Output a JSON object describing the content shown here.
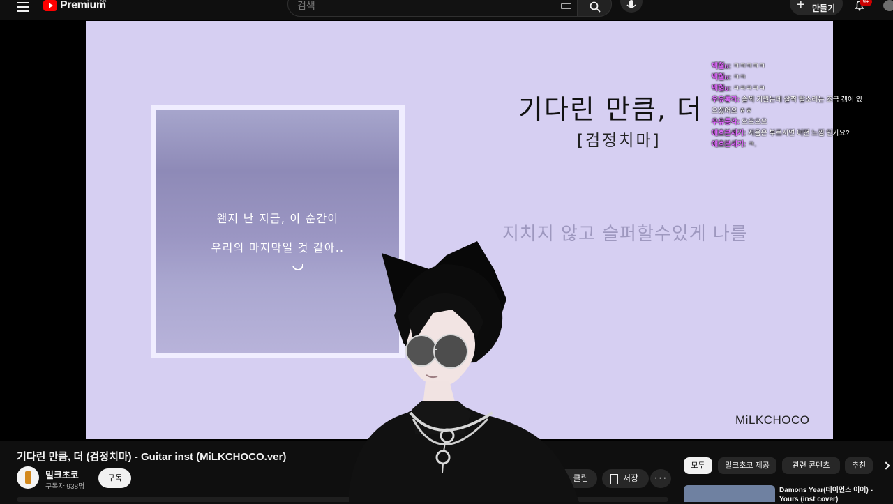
{
  "header": {
    "brand": "Premium",
    "region": "KR",
    "search_placeholder": "검색",
    "create_label": "만들기",
    "notification_badge": "9+",
    "icons": [
      "menu-icon",
      "youtube-logo-icon",
      "keyboard-icon",
      "search-icon",
      "microphone-icon",
      "plus-icon",
      "bell-icon"
    ]
  },
  "video": {
    "frame_lines": [
      "왠지 난 지금, 이 순간이",
      "우리의 마지막일 것 같아.."
    ],
    "song_title": "기다린 만큼, 더",
    "artist": "[검정치마]",
    "lyric": "지치지 않고 슬퍼할수있게 나를",
    "watermark": "MiLKCHOCO",
    "chat": [
      {
        "name": "백혈u:",
        "message": "ㅋㅋㅋㅋㅋ"
      },
      {
        "name": "백혈u:",
        "message": "ㅋㅋ"
      },
      {
        "name": "백혈u:",
        "message": "ㅋㅋㅋㅋㅋ"
      },
      {
        "name": "우유통각:",
        "message": "슬쩍 기웠는데 살짝 탈소리는  조금 갱이 있"
      },
      {
        "name": "",
        "message": "으셨어요 ㅎㅎ"
      },
      {
        "name": "우유통각:",
        "message": "으으으으"
      },
      {
        "name": "얘흐븐세기:",
        "message": "저음은 부르시면 어떤 느낌 인가요?"
      },
      {
        "name": "얘흐븐세기:",
        "message": "ㅋ."
      }
    ]
  },
  "below": {
    "title": "기다린 만큼, 더 (검정치마) - Guitar inst (MiLKCHOCO.ver)",
    "channel_name": "밀크초코",
    "subscribers": "구독자 938명",
    "subscribe": "구독",
    "clip": "클립",
    "save": "저장",
    "more": "···",
    "chips": [
      "모두",
      "밀크초코 제공",
      "관련 콘텐츠",
      "추천"
    ],
    "recommendation_title": "Damons Year(데이먼스 이어) - Yours (inst cover)"
  }
}
